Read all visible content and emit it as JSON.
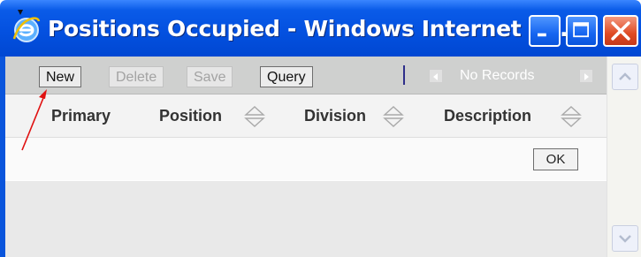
{
  "window": {
    "title": "Positions Occupied - Windows Internet E...",
    "colors": {
      "titlebar": "#0451e0",
      "toolbar": "#cfd0cf",
      "close_button": "#df4b24"
    }
  },
  "toolbar": {
    "new_label": "New",
    "delete_label": "Delete",
    "save_label": "Save",
    "query_label": "Query",
    "records_label": "No Records"
  },
  "table": {
    "columns": [
      "Primary",
      "Position",
      "Division",
      "Description"
    ]
  },
  "form": {
    "ok_label": "OK"
  },
  "icons": [
    "ie-icon",
    "minimize-icon",
    "maximize-icon",
    "close-icon",
    "sort-icon",
    "arrow-left-icon",
    "arrow-right-icon",
    "scroll-up-icon",
    "scroll-down-icon",
    "annotation-arrow"
  ]
}
